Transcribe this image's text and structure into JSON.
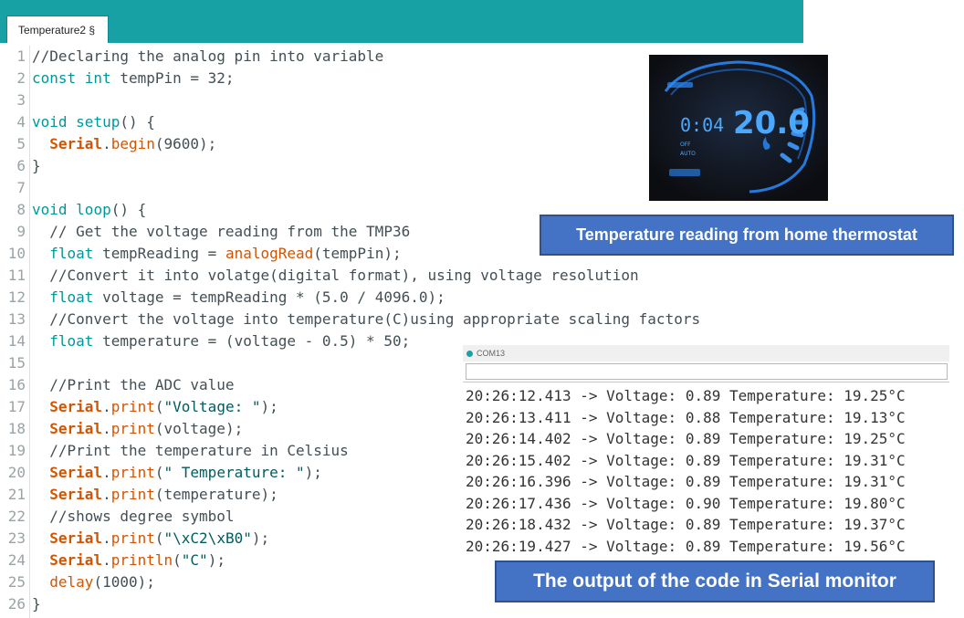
{
  "tab": {
    "label": "Temperature2 §"
  },
  "code_lines": [
    {
      "n": "1",
      "tokens": [
        {
          "t": "//Declaring the analog pin into variable",
          "k": "comment"
        }
      ]
    },
    {
      "n": "2",
      "tokens": [
        {
          "t": "const int",
          "k": "kw"
        },
        {
          "t": " tempPin = 32;",
          "k": "plain"
        }
      ]
    },
    {
      "n": "3",
      "tokens": []
    },
    {
      "n": "4",
      "tokens": [
        {
          "t": "void",
          "k": "kw"
        },
        {
          "t": " ",
          "k": "plain"
        },
        {
          "t": "setup",
          "k": "kw"
        },
        {
          "t": "() {",
          "k": "plain"
        }
      ]
    },
    {
      "n": "5",
      "tokens": [
        {
          "t": "  ",
          "k": "plain"
        },
        {
          "t": "Serial",
          "k": "obj"
        },
        {
          "t": ".",
          "k": "plain"
        },
        {
          "t": "begin",
          "k": "fn"
        },
        {
          "t": "(9600);",
          "k": "plain"
        }
      ]
    },
    {
      "n": "6",
      "tokens": [
        {
          "t": "}",
          "k": "plain"
        }
      ]
    },
    {
      "n": "7",
      "tokens": []
    },
    {
      "n": "8",
      "tokens": [
        {
          "t": "void",
          "k": "kw"
        },
        {
          "t": " ",
          "k": "plain"
        },
        {
          "t": "loop",
          "k": "kw"
        },
        {
          "t": "() {",
          "k": "plain"
        }
      ]
    },
    {
      "n": "9",
      "tokens": [
        {
          "t": "  // Get the voltage reading from the TMP36",
          "k": "comment"
        }
      ]
    },
    {
      "n": "10",
      "tokens": [
        {
          "t": "  ",
          "k": "plain"
        },
        {
          "t": "float",
          "k": "kw"
        },
        {
          "t": " tempReading = ",
          "k": "plain"
        },
        {
          "t": "analogRead",
          "k": "fn"
        },
        {
          "t": "(tempPin);",
          "k": "plain"
        }
      ]
    },
    {
      "n": "11",
      "tokens": [
        {
          "t": "  //Convert it into volatge(digital format), using voltage resolution",
          "k": "comment"
        }
      ]
    },
    {
      "n": "12",
      "tokens": [
        {
          "t": "  ",
          "k": "plain"
        },
        {
          "t": "float",
          "k": "kw"
        },
        {
          "t": " voltage = tempReading * (5.0 / 4096.0);",
          "k": "plain"
        }
      ]
    },
    {
      "n": "13",
      "tokens": [
        {
          "t": "  //Convert the voltage into temperature(C)using appropriate scaling factors",
          "k": "comment"
        }
      ]
    },
    {
      "n": "14",
      "tokens": [
        {
          "t": "  ",
          "k": "plain"
        },
        {
          "t": "float",
          "k": "kw"
        },
        {
          "t": " temperature = (voltage - 0.5) * 50;",
          "k": "plain"
        }
      ]
    },
    {
      "n": "15",
      "tokens": []
    },
    {
      "n": "16",
      "tokens": [
        {
          "t": "  //Print the ADC value",
          "k": "comment"
        }
      ]
    },
    {
      "n": "17",
      "tokens": [
        {
          "t": "  ",
          "k": "plain"
        },
        {
          "t": "Serial",
          "k": "obj"
        },
        {
          "t": ".",
          "k": "plain"
        },
        {
          "t": "print",
          "k": "fn"
        },
        {
          "t": "(",
          "k": "plain"
        },
        {
          "t": "\"Voltage: \"",
          "k": "str"
        },
        {
          "t": ");",
          "k": "plain"
        }
      ]
    },
    {
      "n": "18",
      "tokens": [
        {
          "t": "  ",
          "k": "plain"
        },
        {
          "t": "Serial",
          "k": "obj"
        },
        {
          "t": ".",
          "k": "plain"
        },
        {
          "t": "print",
          "k": "fn"
        },
        {
          "t": "(voltage);",
          "k": "plain"
        }
      ]
    },
    {
      "n": "19",
      "tokens": [
        {
          "t": "  //Print the temperature in Celsius",
          "k": "comment"
        }
      ]
    },
    {
      "n": "20",
      "tokens": [
        {
          "t": "  ",
          "k": "plain"
        },
        {
          "t": "Serial",
          "k": "obj"
        },
        {
          "t": ".",
          "k": "plain"
        },
        {
          "t": "print",
          "k": "fn"
        },
        {
          "t": "(",
          "k": "plain"
        },
        {
          "t": "\" Temperature: \"",
          "k": "str"
        },
        {
          "t": ");",
          "k": "plain"
        }
      ]
    },
    {
      "n": "21",
      "tokens": [
        {
          "t": "  ",
          "k": "plain"
        },
        {
          "t": "Serial",
          "k": "obj"
        },
        {
          "t": ".",
          "k": "plain"
        },
        {
          "t": "print",
          "k": "fn"
        },
        {
          "t": "(temperature);",
          "k": "plain"
        }
      ]
    },
    {
      "n": "22",
      "tokens": [
        {
          "t": "  //shows degree symbol",
          "k": "comment"
        }
      ]
    },
    {
      "n": "23",
      "tokens": [
        {
          "t": "  ",
          "k": "plain"
        },
        {
          "t": "Serial",
          "k": "obj"
        },
        {
          "t": ".",
          "k": "plain"
        },
        {
          "t": "print",
          "k": "fn"
        },
        {
          "t": "(",
          "k": "plain"
        },
        {
          "t": "\"\\xC2\\xB0\"",
          "k": "str"
        },
        {
          "t": ");",
          "k": "plain"
        }
      ]
    },
    {
      "n": "24",
      "tokens": [
        {
          "t": "  ",
          "k": "plain"
        },
        {
          "t": "Serial",
          "k": "obj"
        },
        {
          "t": ".",
          "k": "plain"
        },
        {
          "t": "println",
          "k": "fn"
        },
        {
          "t": "(",
          "k": "plain"
        },
        {
          "t": "\"C\"",
          "k": "str"
        },
        {
          "t": ");",
          "k": "plain"
        }
      ]
    },
    {
      "n": "25",
      "tokens": [
        {
          "t": "  ",
          "k": "plain"
        },
        {
          "t": "delay",
          "k": "fn"
        },
        {
          "t": "(1000);",
          "k": "plain"
        }
      ]
    },
    {
      "n": "26",
      "tokens": [
        {
          "t": "}",
          "k": "plain"
        }
      ]
    }
  ],
  "thermostat": {
    "time": "0:04",
    "temp": "20.0",
    "labels": [
      "OFF",
      "AUTO"
    ],
    "colors": {
      "display": "#2a8cff",
      "glow": "#4aa8ff"
    }
  },
  "callouts": {
    "thermostat": "Temperature reading from home thermostat",
    "serial": "The output of the code in Serial monitor"
  },
  "serial_monitor": {
    "title": "COM13",
    "lines": [
      "20:26:12.413 -> Voltage: 0.89 Temperature: 19.25°C",
      "20:26:13.411 -> Voltage: 0.88 Temperature: 19.13°C",
      "20:26:14.402 -> Voltage: 0.89 Temperature: 19.25°C",
      "20:26:15.402 -> Voltage: 0.89 Temperature: 19.31°C",
      "20:26:16.396 -> Voltage: 0.89 Temperature: 19.31°C",
      "20:26:17.436 -> Voltage: 0.90 Temperature: 19.80°C",
      "20:26:18.432 -> Voltage: 0.89 Temperature: 19.37°C",
      "20:26:19.427 -> Voltage: 0.89 Temperature: 19.56°C"
    ]
  }
}
